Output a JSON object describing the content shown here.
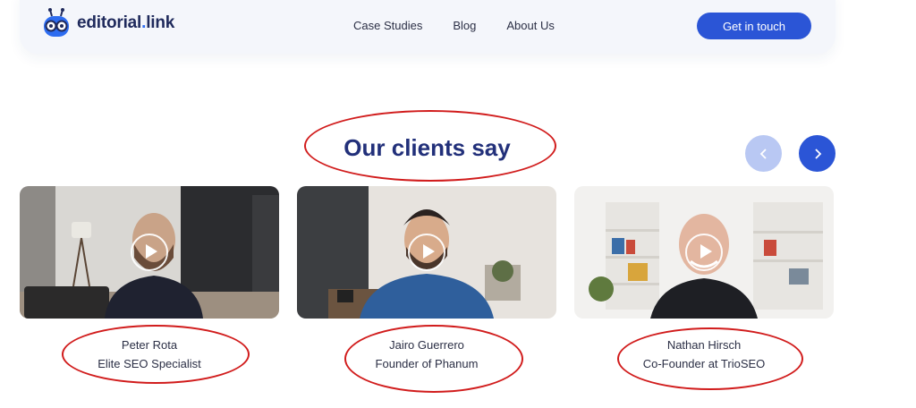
{
  "brand": {
    "name_main": "editorial",
    "name_dot": ".",
    "name_tail": "link"
  },
  "nav": {
    "links": [
      "Case Studies",
      "Blog",
      "About Us"
    ],
    "cta_label": "Get in touch"
  },
  "section": {
    "title": "Our clients say"
  },
  "testimonials": [
    {
      "name": "Peter Rota",
      "role": "Elite SEO Specialist"
    },
    {
      "name": "Jairo Guerrero",
      "role": "Founder of Phanum"
    },
    {
      "name": "Nathan Hirsch",
      "role": "Co-Founder at TrioSEO"
    }
  ],
  "colors": {
    "brand_blue": "#2b55d6",
    "heading": "#22307a",
    "annotation_red": "#d11c1c"
  }
}
